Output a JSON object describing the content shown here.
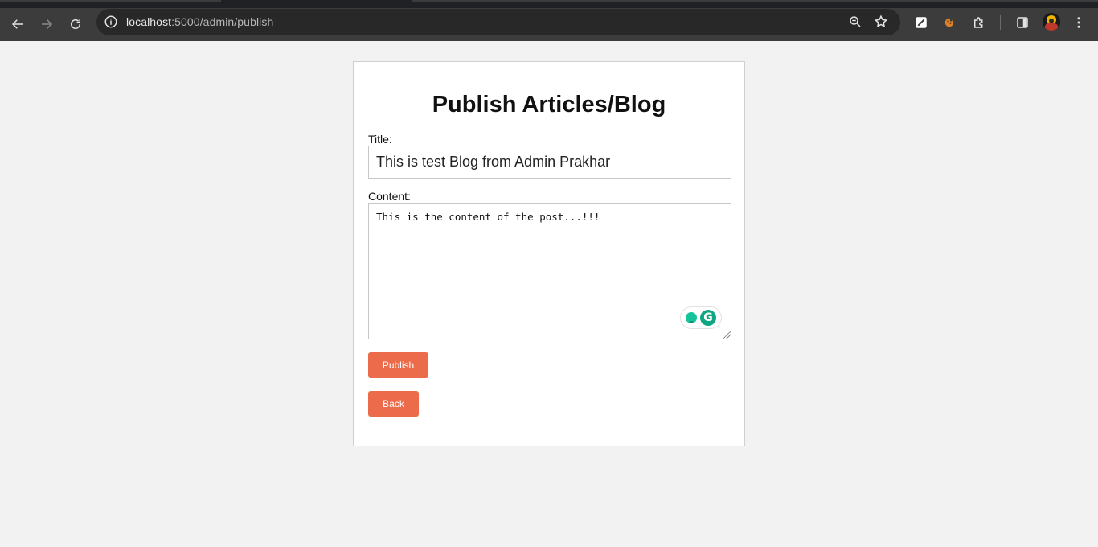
{
  "browser": {
    "url_host": "localhost",
    "url_path": ":5000/admin/publish"
  },
  "page": {
    "heading": "Publish Articles/Blog",
    "title_label": "Title:",
    "title_value": "This is test Blog from Admin Prakhar",
    "content_label": "Content:",
    "content_value": "This is the content of the post...!!!",
    "grammarly_letter": "G",
    "publish_button": "Publish",
    "back_button": "Back"
  },
  "colors": {
    "button": "#ec6b4b",
    "page_background": "#f2f2f2",
    "card_background": "#ffffff"
  }
}
